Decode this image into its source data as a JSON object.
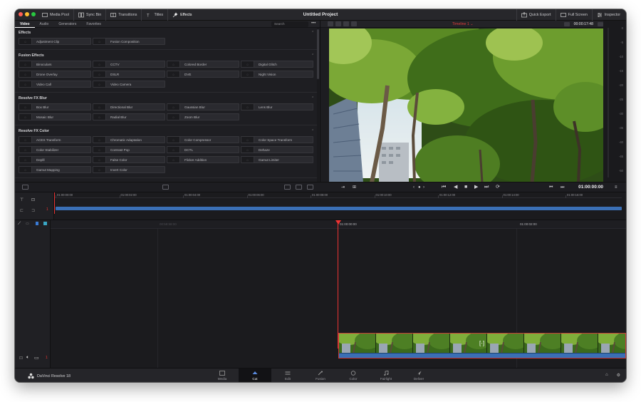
{
  "window": {
    "title": "Untitled Project",
    "traffic_lights": [
      "#ff5f57",
      "#febc2e",
      "#28c840"
    ]
  },
  "toolbar_left": [
    {
      "label": "Media Pool",
      "icon": "media-pool-icon"
    },
    {
      "label": "Sync Bin",
      "icon": "sync-bin-icon"
    },
    {
      "label": "Transitions",
      "icon": "transitions-icon"
    },
    {
      "label": "Titles",
      "icon": "titles-icon"
    },
    {
      "label": "Effects",
      "icon": "effects-icon"
    }
  ],
  "toolbar_right": [
    {
      "label": "Quick Export",
      "icon": "quick-export-icon"
    },
    {
      "label": "Full Screen",
      "icon": "full-screen-icon"
    },
    {
      "label": "Inspector",
      "icon": "inspector-icon"
    }
  ],
  "effects_panel": {
    "tabs": [
      "Video",
      "Audio",
      "Generators",
      "Favorites"
    ],
    "active_tab": "Video",
    "search_placeholder": "Search",
    "sections": [
      {
        "title": "Effects",
        "items": [
          "Adjustment Clip",
          "Fusion Composition"
        ]
      },
      {
        "title": "Fusion Effects",
        "items": [
          "Binoculars",
          "CCTV",
          "Colored Border",
          "Digital Glitch",
          "Drone Overlay",
          "DSLR",
          "DVE",
          "Night Vision",
          "Video Call",
          "Video Camera"
        ]
      },
      {
        "title": "Resolve FX Blur",
        "items": [
          "Box Blur",
          "Directional Blur",
          "Gaussian Blur",
          "Lens Blur",
          "Mosaic Blur",
          "Radial Blur",
          "Zoom Blur"
        ]
      },
      {
        "title": "Resolve FX Color",
        "items": [
          "ACES Transform",
          "Chromatic Adaptation",
          "Color Compressor",
          "Color Space Transform",
          "Color Stabilizer",
          "Contrast Pop",
          "DCTL",
          "Dehaze",
          "Deplll",
          "False Color",
          "Flicker Addition",
          "Gamut Limiter",
          "Gamut Mapping",
          "Invert Color"
        ]
      }
    ]
  },
  "viewer": {
    "timeline_name": "Timeline 1",
    "duration": "00:00:17:48",
    "timecode": "01:00:00:00",
    "audio_meter_marks": [
      "0",
      "-5",
      "-10",
      "-15",
      "-20",
      "-25",
      "-30",
      "-35",
      "-40",
      "-45",
      "-50"
    ]
  },
  "upper_ruler": [
    "01:00:00:00",
    "01:00:02:00",
    "01:00:04:00",
    "01:00:06:00",
    "01:00:08:00",
    "01:00:10:00",
    "01:00:12:00",
    "01:00:14:00",
    "01:00:16:00"
  ],
  "lower_ruler": [
    "00:59:58:00",
    "01:00:00:00",
    "01:00:02:00"
  ],
  "tracks": {
    "video_track": "1",
    "audio_track": "1"
  },
  "bottom_bar": {
    "app_name": "DaVinci Resolve 18",
    "pages": [
      "Media",
      "Cut",
      "Edit",
      "Fusion",
      "Color",
      "Fairlight",
      "Deliver"
    ],
    "active_page": "Cut"
  }
}
